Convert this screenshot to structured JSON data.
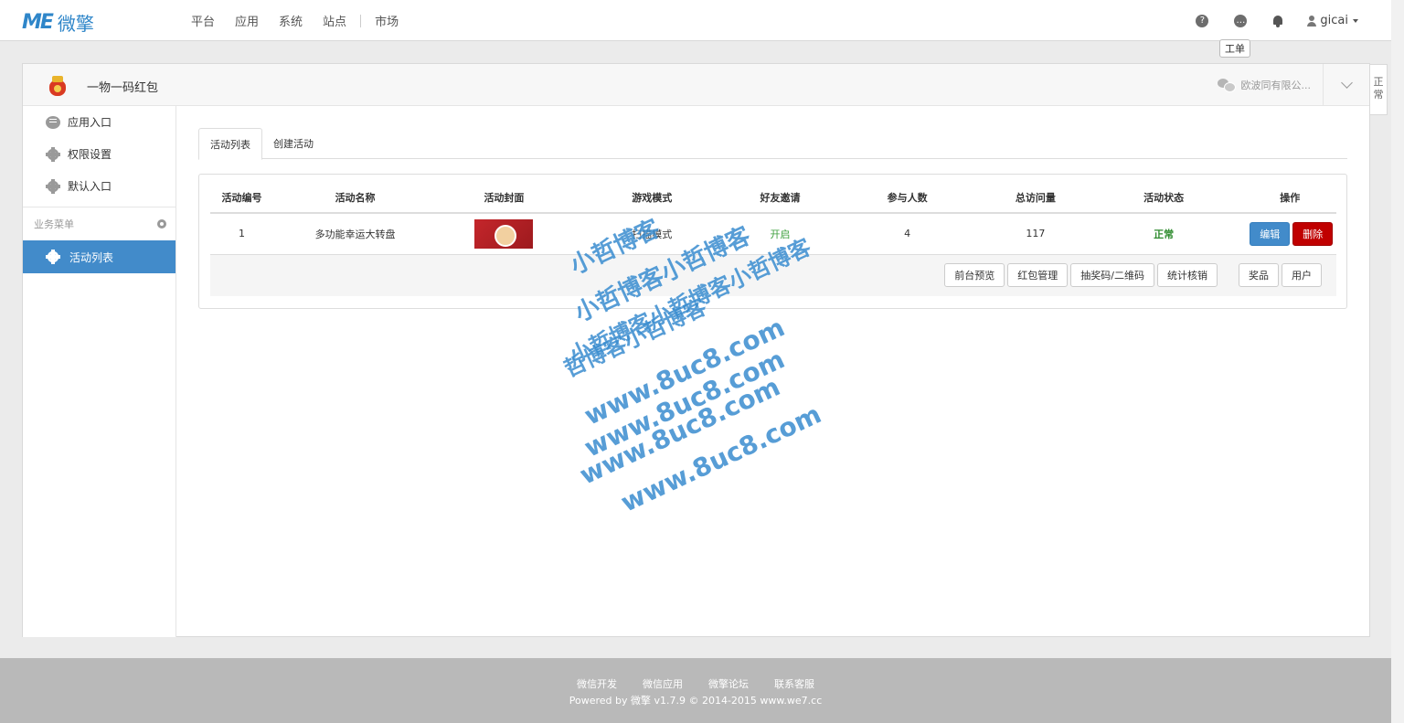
{
  "brand": {
    "logo_mark": "ME",
    "logo_text": "微擎"
  },
  "nav": {
    "items": [
      "平台",
      "应用",
      "系统",
      "站点",
      "市场"
    ]
  },
  "top_right": {
    "help_icon": "question-circle-icon",
    "ticket_icon": "message-icon",
    "bell_icon": "bell-icon",
    "user_name": "gicai",
    "tooltip": "工单"
  },
  "module": {
    "title": "一物一码红包",
    "account": "欧波同有限公...",
    "side_tab": "正常"
  },
  "sidebar": {
    "items": [
      {
        "label": "应用入口",
        "icon": "chat-icon"
      },
      {
        "label": "权限设置",
        "icon": "gear-icon"
      },
      {
        "label": "默认入口",
        "icon": "gear-icon"
      }
    ],
    "section_label": "业务菜单",
    "active_item": "活动列表"
  },
  "tabs": [
    "活动列表",
    "创建活动"
  ],
  "table": {
    "headers": [
      "活动编号",
      "活动名称",
      "活动封面",
      "游戏模式",
      "好友邀请",
      "参与人数",
      "总访问量",
      "活动状态",
      "操作"
    ],
    "rows": [
      {
        "id": "1",
        "name": "多功能幸运大转盘",
        "mode": "扫描模式",
        "invite": "开启",
        "participants": "4",
        "visits": "117",
        "status": "正常",
        "edit": "编辑",
        "delete": "删除"
      }
    ],
    "sub_actions": [
      "前台预览",
      "红包管理",
      "抽奖码/二维码",
      "统计核销",
      "奖品",
      "用户"
    ]
  },
  "watermark": {
    "lines": [
      "小哲博客",
      "小哲博客小哲博客",
      "小哲博客小哲博客小哲博客",
      "哲博客小哲博客",
      "www.8uc8.com",
      "www.8uc8.com",
      "www.8uc8.com",
      "www.8uc8.com"
    ]
  },
  "footer": {
    "links": [
      "微信开发",
      "微信应用",
      "微擎论坛",
      "联系客服"
    ],
    "powered": "Powered by 微擎 v1.7.9 © 2014-2015 www.we7.cc"
  }
}
